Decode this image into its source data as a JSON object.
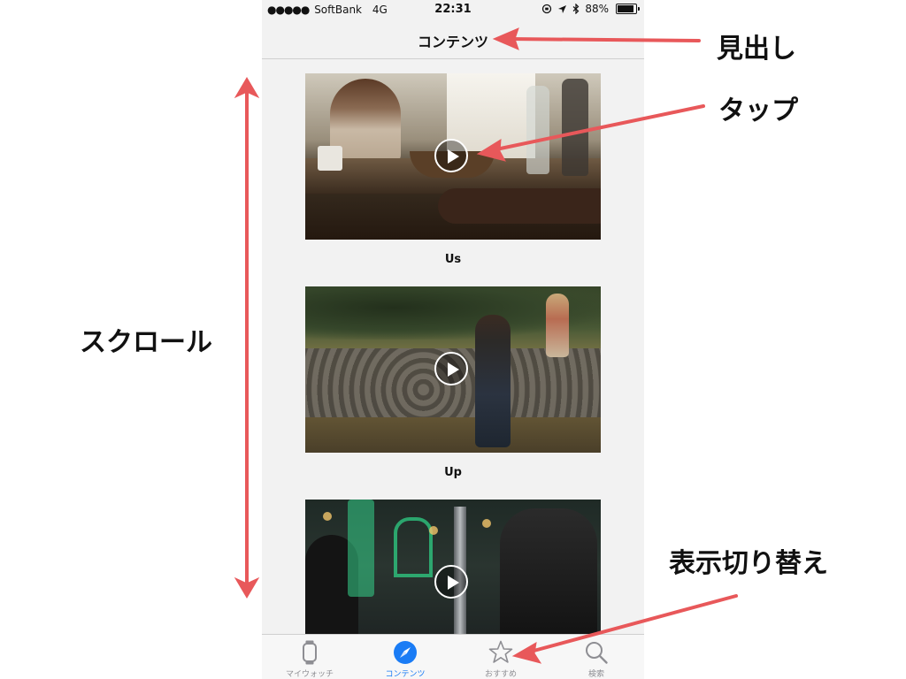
{
  "status_bar": {
    "signal_dots": "●●●●●",
    "carrier": "SoftBank",
    "network": "4G",
    "time": "22:31",
    "battery_percent": "88%",
    "battery_level": 0.88
  },
  "nav": {
    "title": "コンテンツ"
  },
  "videos": [
    {
      "title": "Us"
    },
    {
      "title": "Up"
    },
    {
      "title": ""
    }
  ],
  "tabbar": {
    "tabs": [
      {
        "label": "マイウォッチ",
        "icon": "watch-icon"
      },
      {
        "label": "コンテンツ",
        "icon": "compass-icon",
        "active": true
      },
      {
        "label": "おすすめ",
        "icon": "star-icon"
      },
      {
        "label": "検索",
        "icon": "search-icon"
      }
    ]
  },
  "annotations": {
    "header": "見出し",
    "tap": "タップ",
    "scroll": "スクロール",
    "switch_view": "表示切り替え",
    "arrow_color": "#e8585a"
  },
  "colors": {
    "accent": "#1a7cf5",
    "background": "#f2f2f2"
  }
}
